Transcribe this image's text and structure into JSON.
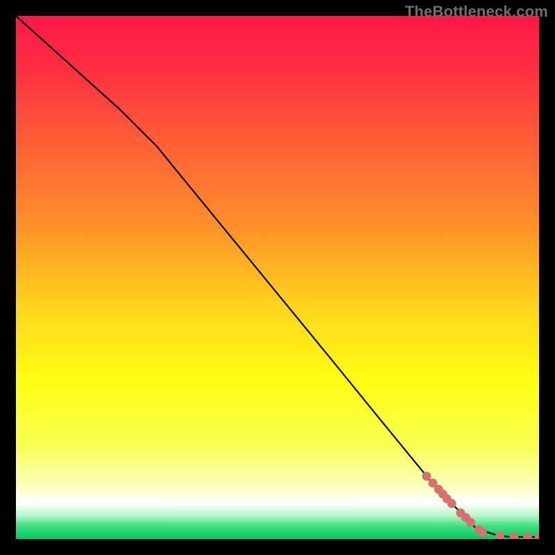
{
  "watermark": "TheBottleneck.com",
  "chart_data": {
    "type": "line",
    "title": "",
    "xlabel": "",
    "ylabel": "",
    "xlim": [
      0,
      100
    ],
    "ylim": [
      0,
      100
    ],
    "grid": false,
    "legend": false,
    "gradient_stops": [
      {
        "offset": 0.0,
        "color": "#ff1846"
      },
      {
        "offset": 0.1,
        "color": "#ff2e42"
      },
      {
        "offset": 0.25,
        "color": "#ff6236"
      },
      {
        "offset": 0.4,
        "color": "#ff8f2a"
      },
      {
        "offset": 0.55,
        "color": "#ffd21e"
      },
      {
        "offset": 0.7,
        "color": "#ffff12"
      },
      {
        "offset": 0.82,
        "color": "#f8ff50"
      },
      {
        "offset": 0.9,
        "color": "#fbffc0"
      },
      {
        "offset": 0.93,
        "color": "#ffffff"
      },
      {
        "offset": 0.955,
        "color": "#b8f8c8"
      },
      {
        "offset": 0.975,
        "color": "#40e080"
      },
      {
        "offset": 1.0,
        "color": "#00c864"
      }
    ],
    "series": [
      {
        "name": "curve",
        "type": "line",
        "color": "#000000",
        "width": 2.2,
        "x": [
          0,
          10,
          20,
          27,
          30,
          40,
          50,
          60,
          70,
          80,
          88,
          92,
          94,
          96,
          100
        ],
        "y": [
          100,
          91,
          82,
          75,
          71.3,
          59.1,
          46.9,
          34.7,
          22.4,
          10.2,
          2.0,
          0.7,
          0.45,
          0.4,
          0.4
        ]
      },
      {
        "name": "markers",
        "type": "scatter",
        "color": "#d97070",
        "radius": 6.5,
        "x": [
          78.5,
          79.7,
          80.8,
          81.6,
          82.4,
          83.3,
          85.0,
          86.0,
          86.9,
          88.5,
          89.2,
          92.5,
          95.2,
          97.8,
          100.0
        ],
        "y": [
          12.0,
          10.7,
          9.5,
          8.6,
          7.7,
          6.8,
          5.0,
          4.1,
          3.2,
          1.8,
          1.3,
          0.6,
          0.45,
          0.4,
          0.4
        ]
      }
    ]
  }
}
